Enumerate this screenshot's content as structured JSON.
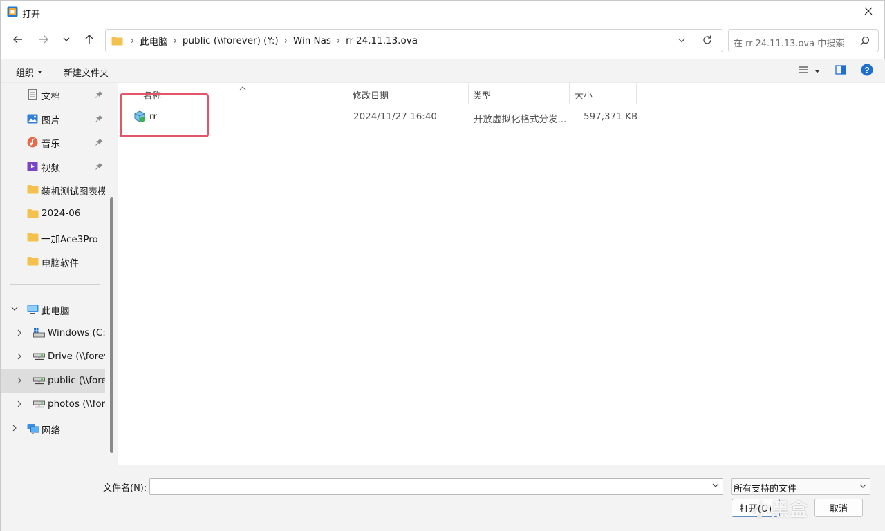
{
  "window": {
    "title": "打开"
  },
  "nav": {
    "breadcrumbs": [
      "此电脑",
      "public (\\\\forever) (Y:)",
      "Win Nas",
      "rr-24.11.13.ova"
    ],
    "search_placeholder": "在 rr-24.11.13.ova 中搜索"
  },
  "toolbar": {
    "organize_label": "组织",
    "new_folder_label": "新建文件夹"
  },
  "sidebar": {
    "quick_access": [
      {
        "label": "文档",
        "icon": "documents-icon",
        "pinned": true
      },
      {
        "label": "图片",
        "icon": "pictures-icon",
        "pinned": true
      },
      {
        "label": "音乐",
        "icon": "music-icon",
        "pinned": true
      },
      {
        "label": "视频",
        "icon": "videos-icon",
        "pinned": true
      },
      {
        "label": "装机测试图表模",
        "icon": "folder-icon",
        "pinned": false
      },
      {
        "label": "2024-06",
        "icon": "folder-icon",
        "pinned": false
      },
      {
        "label": "一加Ace3Pro",
        "icon": "folder-icon",
        "pinned": false
      },
      {
        "label": "电脑软件",
        "icon": "folder-icon",
        "pinned": false
      }
    ],
    "this_pc": "此电脑",
    "drives": [
      {
        "label": "Windows (C:)",
        "icon": "windows-drive-icon"
      },
      {
        "label": "Drive (\\\\forever",
        "icon": "network-drive-icon"
      },
      {
        "label": "public (\\\\forev",
        "icon": "network-drive-icon",
        "selected": true
      },
      {
        "label": "photos (\\\\fore",
        "icon": "network-drive-icon"
      }
    ],
    "network": "网络"
  },
  "columns": {
    "name": "名称",
    "modified": "修改日期",
    "type": "类型",
    "size": "大小"
  },
  "files": [
    {
      "name": "rr",
      "modified": "2024/11/27 16:40",
      "type": "开放虚拟化格式分发...",
      "size": "597,371 KB"
    }
  ],
  "bottom": {
    "filename_label": "文件名(N):",
    "filename_value": "",
    "filetype_value": "所有支持的文件",
    "open_label": "打开(O)",
    "cancel_label": "取消",
    "watermark": "小黑盒"
  },
  "colors": {
    "highlight": "#e2566a",
    "folder": "#f2c14e",
    "accent": "#1f6fd1"
  }
}
